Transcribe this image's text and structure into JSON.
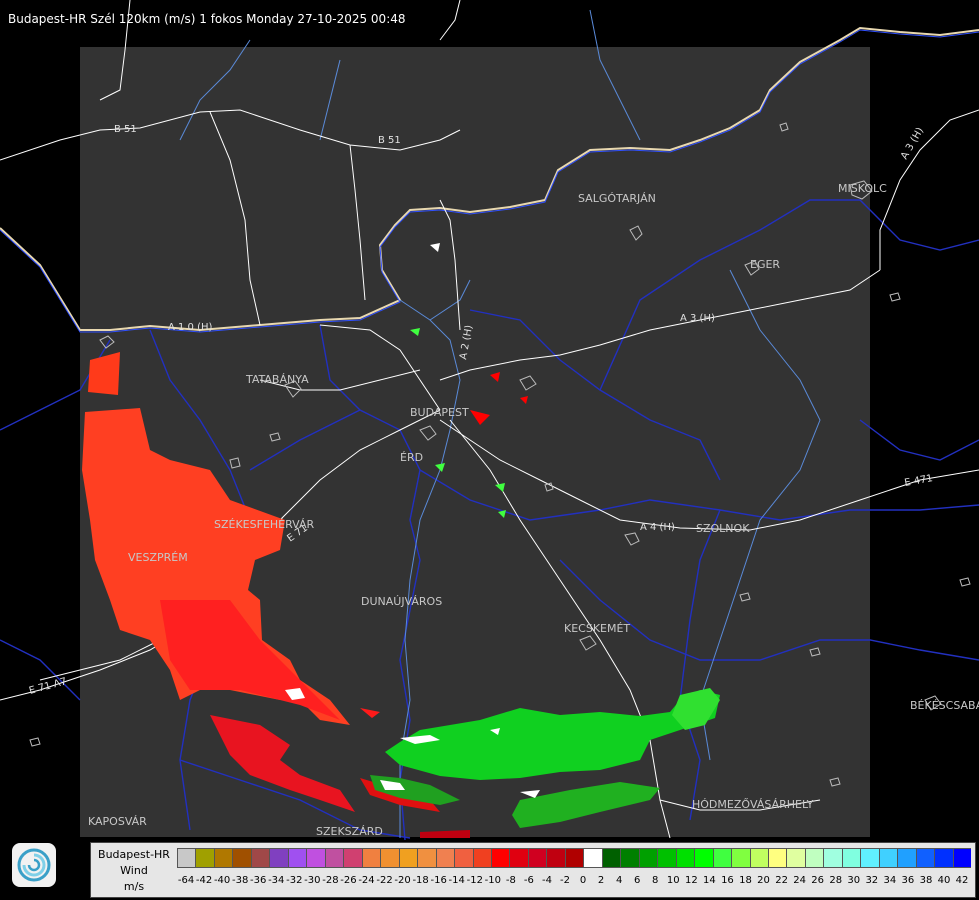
{
  "title": "Budapest-HR Szél 120km (m/s) 1 fokos Monday 27-10-2025 00:48",
  "cities": [
    "SALGÓTARJÁN",
    "MISKOLC",
    "EGER",
    "TATABÁNYA",
    "BUDAPEST",
    "ÉRD",
    "SZÉKESFEHÉRVÁR",
    "VESZPRÉM",
    "DUNAÚJVÁROS",
    "KECSKEMÉT",
    "SZOLNOK",
    "KAPOSVÁR",
    "SZEKSZÁRD",
    "HÓDMEZŐVÁSÁRHELY",
    "BÉKÉSCSABA"
  ],
  "roads": [
    "B 51",
    "B 51",
    "A 1 0 (H)",
    "A 2 (H)",
    "A 3 (H)",
    "A 3 (H)",
    "A 4 (H)",
    "E 71",
    "E 71 A7",
    "E 471"
  ],
  "legend": {
    "line1": "Budapest-HR",
    "line2": "Wind",
    "line3": "m/s",
    "ticks": [
      "-64",
      "-42",
      "-40",
      "-38",
      "-36",
      "-34",
      "-32",
      "-30",
      "-28",
      "-26",
      "-24",
      "-22",
      "-20",
      "-18",
      "-16",
      "-14",
      "-12",
      "-10",
      "-8",
      "-6",
      "-4",
      "-2",
      "0",
      "2",
      "4",
      "6",
      "8",
      "10",
      "12",
      "14",
      "16",
      "18",
      "20",
      "22",
      "24",
      "26",
      "28",
      "30",
      "32",
      "34",
      "36",
      "38",
      "40",
      "42"
    ],
    "colors": [
      "#c8c8c8",
      "#a0a000",
      "#b07800",
      "#a05000",
      "#a04848",
      "#8040c0",
      "#a050f0",
      "#c050e0",
      "#c050a0",
      "#d04070",
      "#f08040",
      "#f09030",
      "#f0a020",
      "#f09040",
      "#f08050",
      "#f06040",
      "#f04020",
      "#ff0000",
      "#e00010",
      "#d00020",
      "#c00010",
      "#b00000",
      "#ffffff",
      "#006000",
      "#008000",
      "#00a000",
      "#00c000",
      "#00e000",
      "#00ff00",
      "#40ff40",
      "#80ff40",
      "#c0ff60",
      "#ffff80",
      "#e0ffa0",
      "#c0ffc0",
      "#a0ffe0",
      "#80ffe0",
      "#60f0ff",
      "#40d0ff",
      "#20a0ff",
      "#1060ff",
      "#0030ff",
      "#0000ff"
    ]
  }
}
